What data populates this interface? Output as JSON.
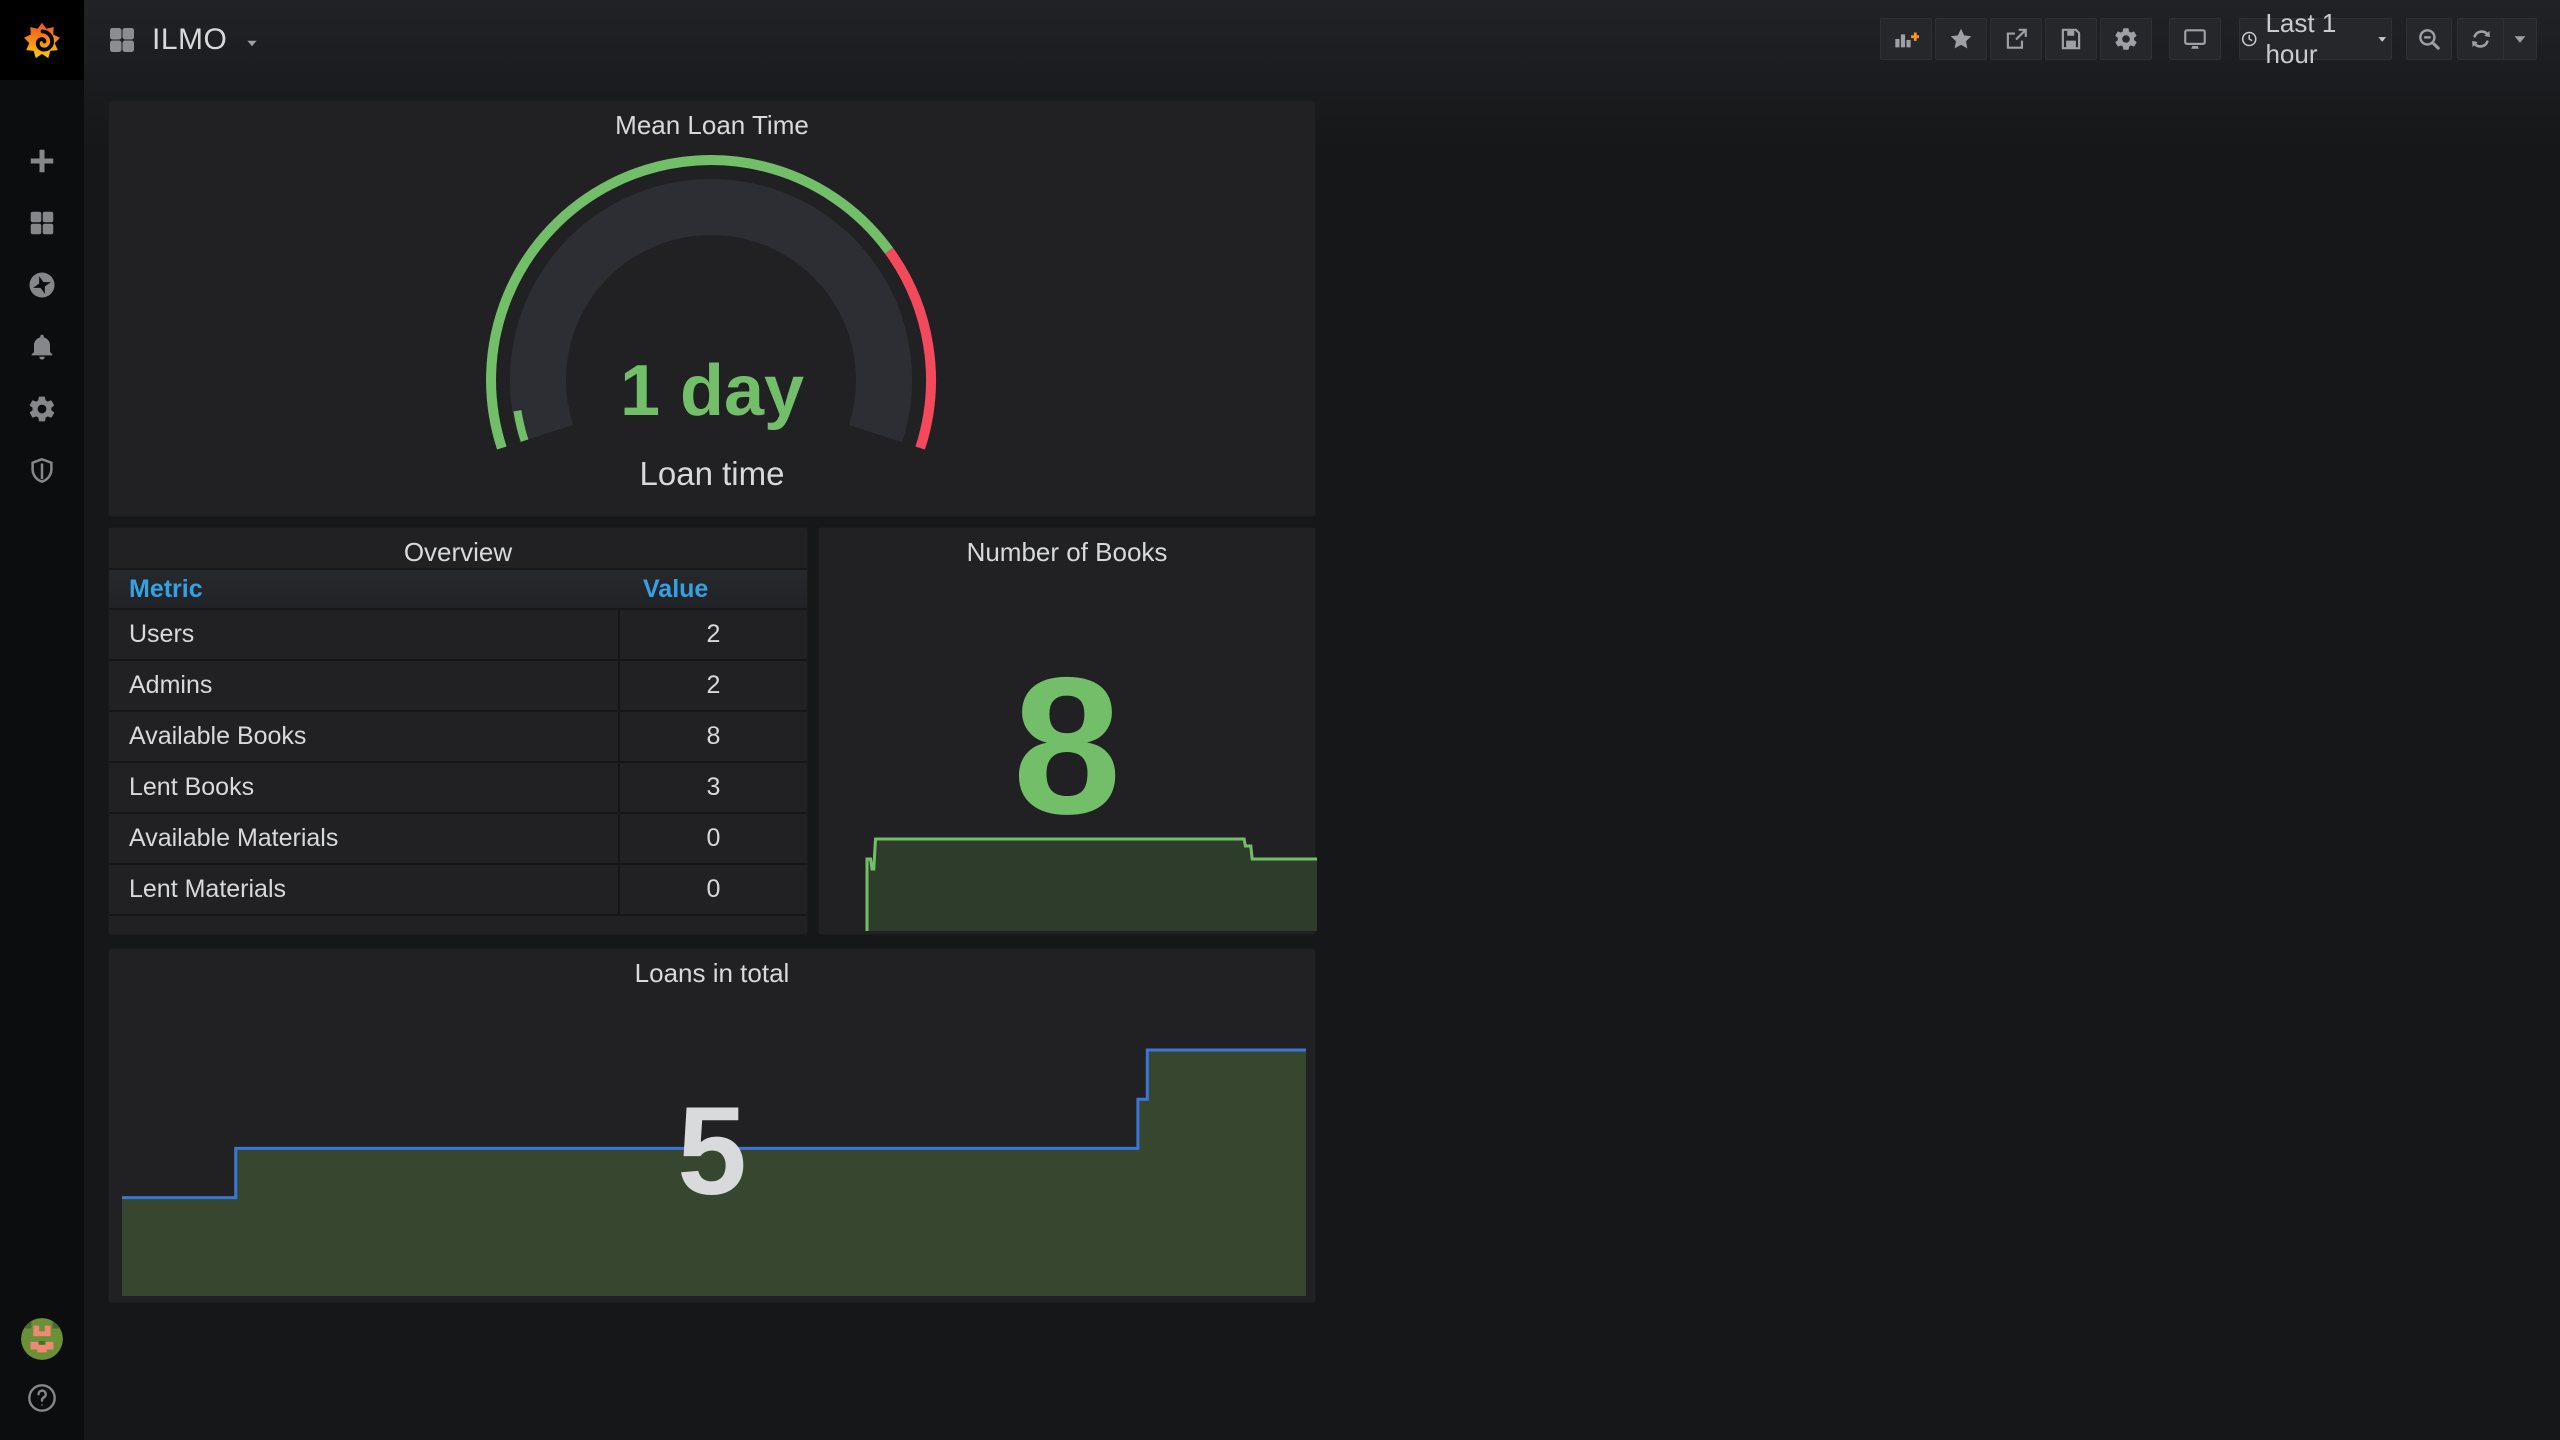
{
  "app": {
    "name": "Grafana dashboard"
  },
  "colors": {
    "green": "#73BF69",
    "red": "#F2495C",
    "header_blue": "#33A2E5",
    "loans_line_blue": "#3A76D9",
    "loans_fill_green": "#36462F",
    "books_fill_green": "#2D3C2B",
    "text_gray": "#D8D9DA",
    "panel_bg": "#212124",
    "page_bg": "#161719"
  },
  "navbar": {
    "title": "ILMO",
    "left_icons": [
      "dashboard-squares-icon",
      "chevron-down-icon"
    ],
    "right_buttons": [
      "add-panel-icon",
      "star-icon",
      "share-icon",
      "save-icon",
      "dashboard-settings-icon",
      "tv-mode-icon"
    ],
    "time_picker": {
      "icon": "clock-icon",
      "label": "Last 1 hour",
      "caret": "chevron-down-icon"
    },
    "zoom_out": "zoom-out-icon",
    "refresh": {
      "icon": "refresh-icon",
      "caret": "chevron-down-icon"
    }
  },
  "sidebar": {
    "items": [
      "create-icon",
      "dashboards-icon",
      "explore-icon",
      "alerting-icon",
      "configuration-icon",
      "server-admin-icon"
    ],
    "bottom": [
      "user-avatar",
      "help-icon"
    ]
  },
  "panels": {
    "gauge": {
      "title": "Mean Loan Time",
      "value": "1 day",
      "label": "Loan time"
    },
    "overview": {
      "title": "Overview",
      "columns": [
        "Metric",
        "Value"
      ],
      "rows": [
        {
          "metric": "Users",
          "value": "2"
        },
        {
          "metric": "Admins",
          "value": "2"
        },
        {
          "metric": "Available Books",
          "value": "8"
        },
        {
          "metric": "Lent Books",
          "value": "3"
        },
        {
          "metric": "Available Materials",
          "value": "0"
        },
        {
          "metric": "Lent Materials",
          "value": "0"
        }
      ]
    },
    "books": {
      "title": "Number of Books",
      "value": "8"
    },
    "loans": {
      "title": "Loans in total",
      "value": "5"
    }
  },
  "chart_data": [
    {
      "id": "gauge",
      "type": "gauge",
      "title": "Mean Loan Time",
      "value_text": "1 day",
      "value_label": "Loan time",
      "thresholds": [
        {
          "color": "#73BF69",
          "span_fraction": 0.75
        },
        {
          "color": "#F2495C",
          "span_fraction": 0.25
        }
      ]
    },
    {
      "id": "books",
      "type": "area",
      "title": "Number of Books",
      "current": 8,
      "line_color": "#73BF69",
      "fill_color": "#2D3C2B",
      "points": [
        [
          0,
          8
        ],
        [
          0.008,
          8
        ],
        [
          0.011,
          7.5
        ],
        [
          0.015,
          7.5
        ],
        [
          0.019,
          9
        ],
        [
          0.838,
          9
        ],
        [
          0.841,
          8.65
        ],
        [
          0.853,
          8.65
        ],
        [
          0.856,
          8
        ],
        [
          1,
          8
        ]
      ]
    },
    {
      "id": "loans",
      "type": "area",
      "title": "Loans in total",
      "current": 5,
      "line_color": "#3A76D9",
      "fill_color": "#36462F",
      "points": [
        [
          0,
          2
        ],
        [
          0.096,
          2
        ],
        [
          0.096,
          3
        ],
        [
          0.858,
          3
        ],
        [
          0.858,
          4
        ],
        [
          0.866,
          4
        ],
        [
          0.866,
          5
        ],
        [
          1,
          5
        ]
      ]
    }
  ]
}
